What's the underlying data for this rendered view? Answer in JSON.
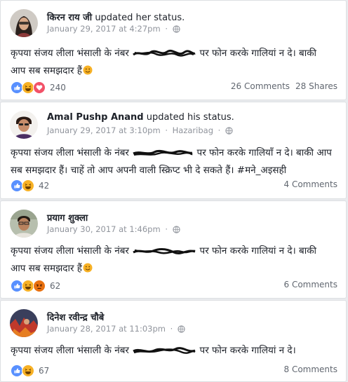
{
  "posts": [
    {
      "author": "किरन राय जी",
      "action": "updated her status.",
      "timestamp": "January 29, 2017 at 4:27pm",
      "location": "",
      "text_before": "कृपया संजय लीला भंसाली के नंबर",
      "text_after": "पर फोन करके गालियां न दे। बाकी आप सब समझदार हैं",
      "trailing_emoji": "smiling-face",
      "reactions": [
        "like",
        "haha",
        "love"
      ],
      "reaction_count": "240",
      "comments": "26 Comments",
      "shares": "28 Shares"
    },
    {
      "author": "Amal Pushp Anand",
      "action": "updated his status.",
      "timestamp": "January 29, 2017 at 3:10pm",
      "location": "Hazaribag",
      "text_before": "कृपया संजय लीला भंसाली के नंबर",
      "text_after": "पर फोन करके गालियाँ न दे। बाकी आप सब समझदार हैं। चाहें तो आप अपनी वाली स्क्रिप्ट भी दे सकते हैं। #मने_अइसही",
      "trailing_emoji": "",
      "reactions": [
        "like",
        "haha"
      ],
      "reaction_count": "42",
      "comments": "4 Comments",
      "shares": ""
    },
    {
      "author": "प्रयाग शुक्ला",
      "action": "",
      "timestamp": "January 30, 2017 at 1:46pm",
      "location": "",
      "text_before": "कृपया संजय लीला भंसाली के नंबर",
      "text_after": "पर फोन करके गालियां न दे। बाकी आप सब समझदार हैं",
      "trailing_emoji": "smiling-face",
      "reactions": [
        "like",
        "haha",
        "angry"
      ],
      "reaction_count": "62",
      "comments": "6 Comments",
      "shares": ""
    },
    {
      "author": "दिनेश रवीन्द्र चौबे",
      "action": "",
      "timestamp": "January 28, 2017 at 11:03pm",
      "location": "",
      "text_before": "कृपया संजय लीला भंसाली के नंबर",
      "text_after": "पर फोन करके गालियां न दे।",
      "trailing_emoji": "",
      "reactions": [
        "like",
        "haha"
      ],
      "reaction_count": "67",
      "comments": "8 Comments",
      "shares": ""
    }
  ],
  "icons": {
    "globe": "globe-icon",
    "like": "like-reaction-icon",
    "haha": "haha-reaction-icon",
    "love": "love-reaction-icon",
    "angry": "angry-reaction-icon"
  },
  "colors": {
    "like": "#5890ff",
    "haha": "#f7b125",
    "love": "#f25268",
    "angry": "#e9710f",
    "meta": "#90949c",
    "text": "#1d2129",
    "feed_bg": "#e9ebee"
  }
}
